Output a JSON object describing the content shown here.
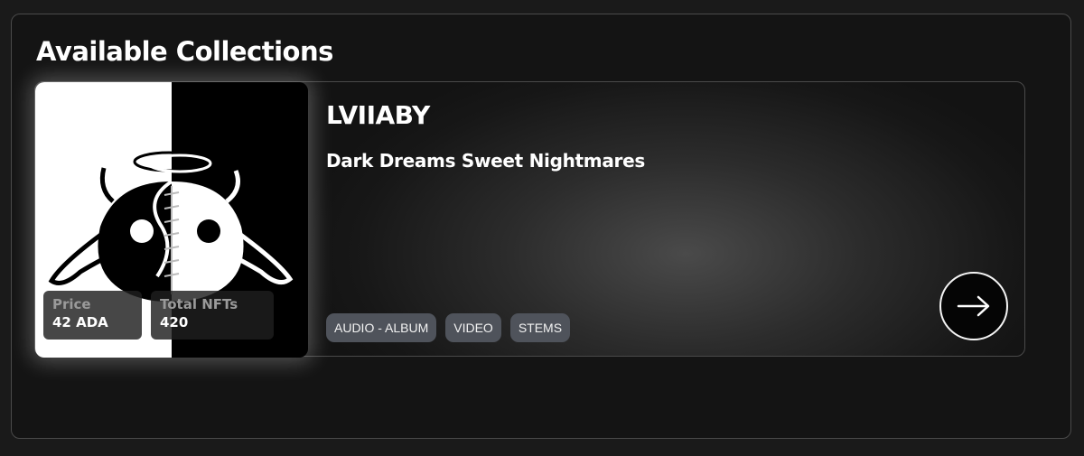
{
  "section": {
    "title": "Available Collections"
  },
  "card": {
    "artist": "LVIIABY",
    "collection_name": "Dark Dreams Sweet Nightmares",
    "stats": {
      "price_label": "Price",
      "price_value": "42 ADA",
      "total_label": "Total NFTs",
      "total_value": "420"
    },
    "tags": [
      "AUDIO - ALBUM",
      "VIDEO",
      "STEMS"
    ],
    "open_icon": "arrow-right-icon",
    "artwork_icon": "lviiaby-character-artwork"
  },
  "colors": {
    "background": "#141414",
    "tag_bg": "#4f535b",
    "text": "#ffffff"
  }
}
